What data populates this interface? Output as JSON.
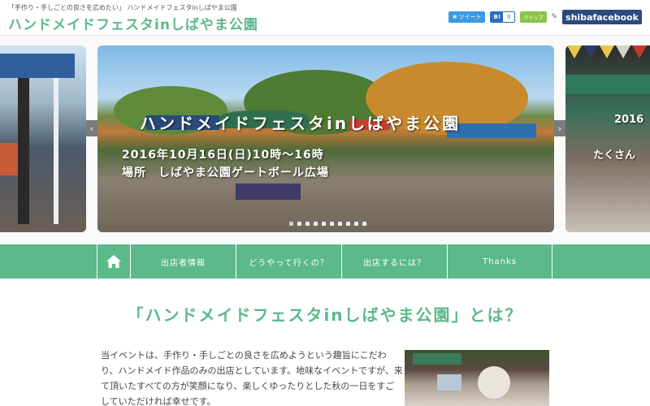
{
  "header": {
    "tagline": "「手作り・手しごとの良さを広めたい」 ハンドメイドフェスタinしばやま公園",
    "site_title": "ハンドメイドフェスタinしばやま公園",
    "social": {
      "tweet_label": "ツイート",
      "hatena_label": "B!",
      "hatena_count": "0",
      "clip_label": "クリップ",
      "facebook_label": "shibafacebook"
    }
  },
  "slider": {
    "main": {
      "title": "ハンドメイドフェスタinしばやま公園",
      "date": "2016年10月16日(日)10時〜16時",
      "place": "場所　しばやま公園ゲートボール広場"
    },
    "right_preview": {
      "line1": "2016",
      "line2": "たくさん"
    },
    "prev_label": "‹",
    "next_label": "›",
    "dot_count": 10,
    "active_dot": 1
  },
  "nav": {
    "items": [
      {
        "label": "出店者情報"
      },
      {
        "label": "どうやって行くの？"
      },
      {
        "label": "出店するには？"
      },
      {
        "label": "Thanks"
      }
    ]
  },
  "main": {
    "section_title": "「ハンドメイドフェスタinしばやま公園」とは？",
    "about_text": "当イベントは、手作り・手しごとの良さを広めようという趣旨にこだわり、ハンドメイド作品のみの出店としています。地味なイベントですが、来て頂いたすべての方が笑顔になり、楽しくゆったりとした秋の一日をすごしていただければ幸せです。"
  },
  "colors": {
    "brand_green": "#5bb98a",
    "twitter_blue": "#3b9ae1",
    "hatena_blue": "#2c6ebd",
    "facebook_navy": "#2b4a7e"
  },
  "icons": {
    "home": "home-icon",
    "prev": "chevron-left-icon",
    "next": "chevron-right-icon",
    "twitter": "twitter-bird-icon"
  }
}
